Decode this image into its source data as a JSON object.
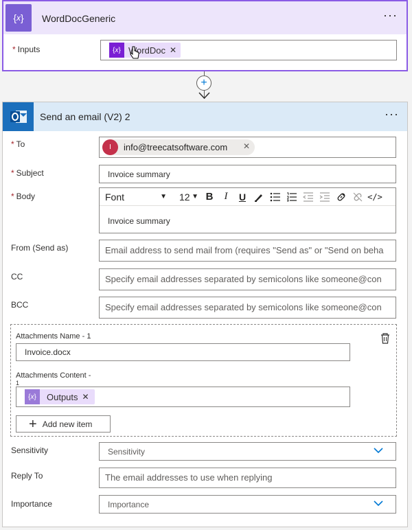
{
  "compose_card": {
    "title": "WordDocGeneric",
    "more_glyph": "···",
    "inputs_label": "Inputs",
    "required_mark": "*",
    "input_token": {
      "label": "WordDoc",
      "icon": "variable-icon"
    }
  },
  "connector": {
    "plus": "+"
  },
  "email_card": {
    "title": "Send an email (V2) 2",
    "more_glyph": "···",
    "icon": "outlook-icon",
    "to": {
      "label": "To",
      "avatar_initial": "I",
      "recipient": "info@treecatsoftware.com"
    },
    "subject": {
      "label": "Subject",
      "value": "Invoice summary"
    },
    "body": {
      "label": "Body",
      "font_select": "Font",
      "size_select": "12",
      "bold": "B",
      "italic": "I",
      "underline": "U",
      "content": "Invoice summary"
    },
    "from": {
      "label": "From (Send as)",
      "placeholder": "Email address to send mail from (requires \"Send as\" or \"Send on beha"
    },
    "cc": {
      "label": "CC",
      "placeholder": "Specify email addresses separated by semicolons like someone@con"
    },
    "bcc": {
      "label": "BCC",
      "placeholder": "Specify email addresses separated by semicolons like someone@con"
    },
    "attachments": {
      "name_label": "Attachments Name - 1",
      "name_value": "Invoice.docx",
      "content_label": "Attachments Content -",
      "content_label_2": "1",
      "content_token": {
        "label": "Outputs",
        "icon": "variable-icon"
      },
      "add_button": "Add new item"
    },
    "sensitivity": {
      "label": "Sensitivity",
      "value": "Sensitivity"
    },
    "reply_to": {
      "label": "Reply To",
      "placeholder": "The email addresses to use when replying"
    },
    "importance": {
      "label": "Importance",
      "value": "Importance"
    }
  },
  "colors": {
    "accent_purple": "#8a5be5",
    "token_purple": "#7a1fd4",
    "outlook_blue": "#1c6fbc",
    "chevron_blue": "#0078d4",
    "required_red": "#a4262c"
  }
}
